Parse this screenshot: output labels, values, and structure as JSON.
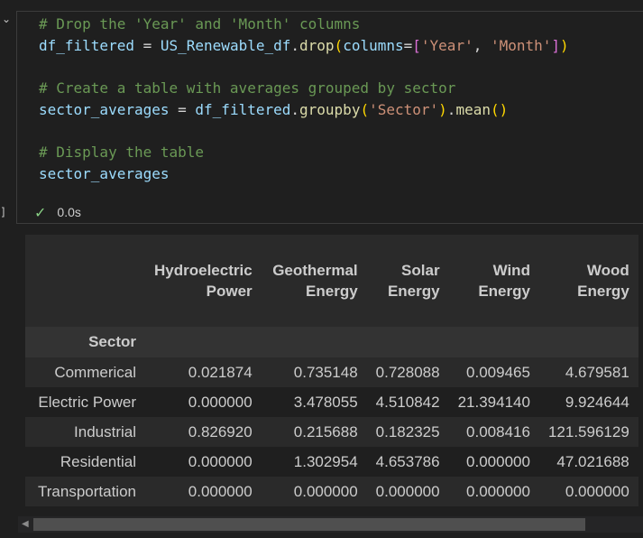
{
  "cell": {
    "code_lines": [
      [
        {
          "t": "# Drop the 'Year' and 'Month' columns",
          "c": "cm"
        }
      ],
      [
        {
          "t": "df_filtered",
          "c": "id"
        },
        {
          "t": " = ",
          "c": "op"
        },
        {
          "t": "US_Renewable_df",
          "c": "id"
        },
        {
          "t": ".",
          "c": "op"
        },
        {
          "t": "drop",
          "c": "fn"
        },
        {
          "t": "(",
          "c": "b1"
        },
        {
          "t": "columns",
          "c": "id"
        },
        {
          "t": "=",
          "c": "op"
        },
        {
          "t": "[",
          "c": "b2"
        },
        {
          "t": "'Year'",
          "c": "st"
        },
        {
          "t": ", ",
          "c": "op"
        },
        {
          "t": "'Month'",
          "c": "st"
        },
        {
          "t": "]",
          "c": "b2"
        },
        {
          "t": ")",
          "c": "b1"
        }
      ],
      [],
      [
        {
          "t": "# Create a table with averages grouped by sector",
          "c": "cm"
        }
      ],
      [
        {
          "t": "sector_averages",
          "c": "id"
        },
        {
          "t": " = ",
          "c": "op"
        },
        {
          "t": "df_filtered",
          "c": "id"
        },
        {
          "t": ".",
          "c": "op"
        },
        {
          "t": "groupby",
          "c": "fn"
        },
        {
          "t": "(",
          "c": "b1"
        },
        {
          "t": "'Sector'",
          "c": "st"
        },
        {
          "t": ")",
          "c": "b1"
        },
        {
          "t": ".",
          "c": "op"
        },
        {
          "t": "mean",
          "c": "fn"
        },
        {
          "t": "()",
          "c": "b1"
        }
      ],
      [],
      [
        {
          "t": "# Display the table",
          "c": "cm"
        }
      ],
      [
        {
          "t": "sector_averages",
          "c": "id"
        }
      ]
    ],
    "exec_time": "0.0s",
    "gutter_bracket": "]"
  },
  "output": {
    "columns": [
      "Hydroelectric\nPower",
      "Geothermal\nEnergy",
      "Solar\nEnergy",
      "Wind\nEnergy",
      "Wood\nEnergy"
    ],
    "index_name": "Sector",
    "rows": [
      {
        "index": "Commerical",
        "values": [
          "0.021874",
          "0.735148",
          "0.728088",
          "0.009465",
          "4.679581"
        ]
      },
      {
        "index": "Electric Power",
        "values": [
          "0.000000",
          "3.478055",
          "4.510842",
          "21.394140",
          "9.924644"
        ]
      },
      {
        "index": "Industrial",
        "values": [
          "0.826920",
          "0.215688",
          "0.182325",
          "0.008416",
          "121.596129"
        ]
      },
      {
        "index": "Residential",
        "values": [
          "0.000000",
          "1.302954",
          "4.653786",
          "0.000000",
          "47.021688"
        ]
      },
      {
        "index": "Transportation",
        "values": [
          "0.000000",
          "0.000000",
          "0.000000",
          "0.000000",
          "0.000000"
        ]
      }
    ]
  },
  "icons": {
    "collapse": "chevron-down-icon",
    "status": "check-icon",
    "scroll_left": "scroll-left-arrow-icon"
  },
  "colors": {
    "background": "#1f1f1f",
    "comment": "#6a9955",
    "identifier": "#9cdcfe",
    "function": "#dcdcaa",
    "string": "#ce9178",
    "success": "#89d185"
  }
}
